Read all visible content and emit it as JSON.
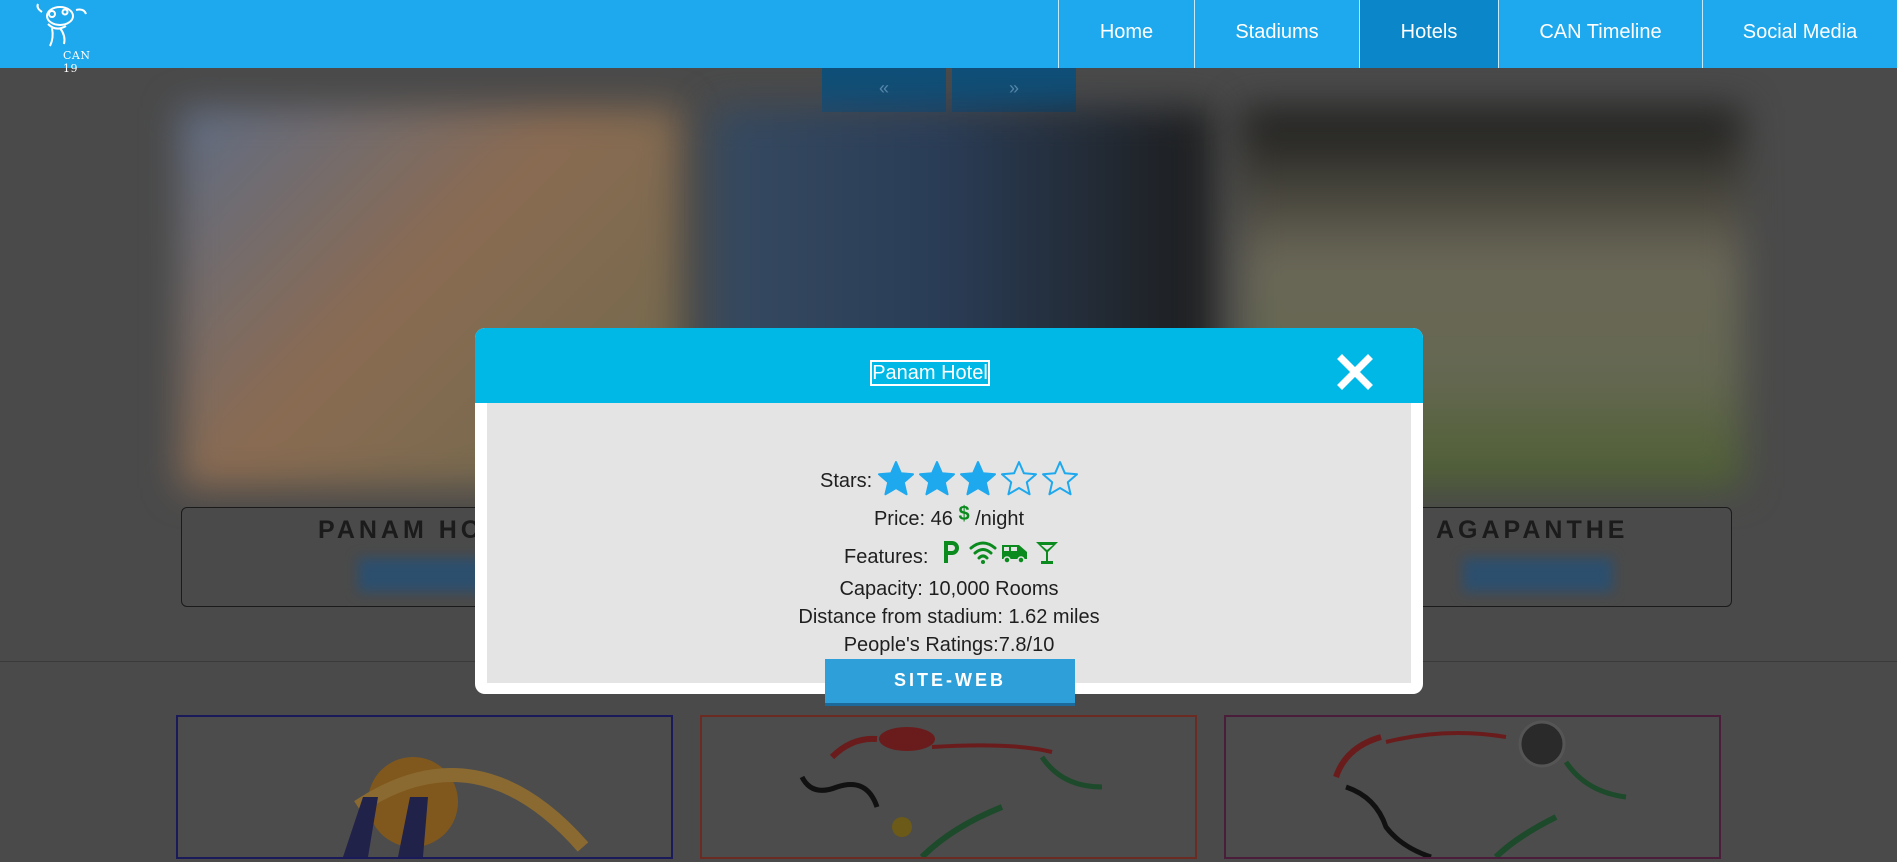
{
  "navbar": {
    "logo_text": "CAN 19",
    "items": [
      "Home",
      "Stadiums",
      "Hotels",
      "CAN Timeline",
      "Social Media"
    ],
    "active_index": 2
  },
  "slider": {
    "prev_label": "«",
    "next_label": "»"
  },
  "background": {
    "hotel_names": [
      "PANAM HO",
      "AGAPANTHE"
    ]
  },
  "modal": {
    "title": "Panam Hotel",
    "stars_label": "Stars:",
    "stars": 3,
    "stars_max": 5,
    "price_label": "Price: 46",
    "price_currency": "$",
    "price_suffix": "/night",
    "features_label": "Features:",
    "features": [
      "parking-icon",
      "wifi-icon",
      "shuttle-bus-icon",
      "cocktail-bar-icon"
    ],
    "capacity": "Capacity: 10,000 Rooms",
    "distance": "Distance from stadium: 1.62 miles",
    "ratings": "People's Ratings:7.8/10",
    "site_button": "SITE-WEB"
  },
  "colors": {
    "navbar": "#1ea9ee",
    "nav_active": "#0b86c9",
    "modal_header": "#00b8e6",
    "star": "#1ea9ee",
    "feature_icons": "#0b8a1e",
    "site_button": "#2e9fd8"
  }
}
